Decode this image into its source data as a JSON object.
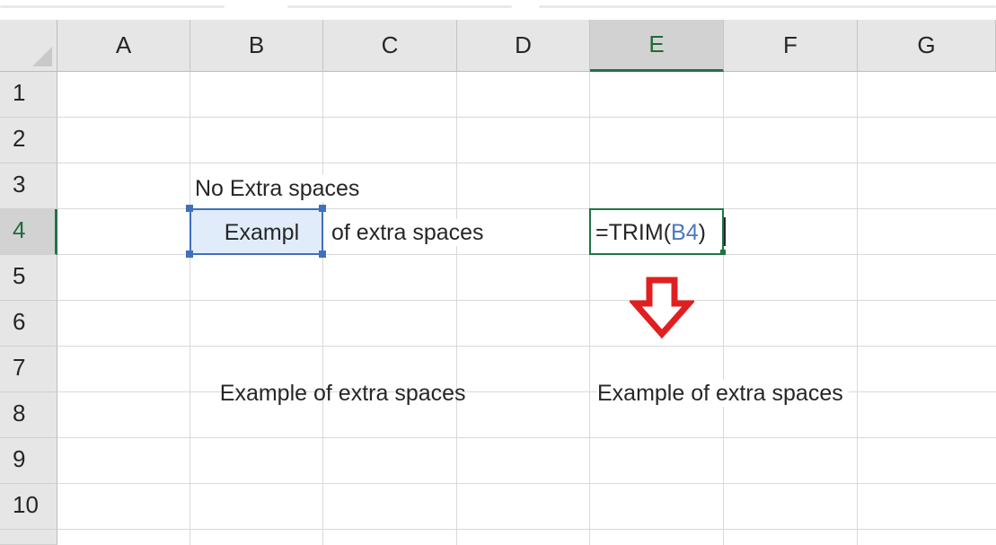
{
  "columns": [
    "A",
    "B",
    "C",
    "D",
    "E",
    "F",
    "G"
  ],
  "active_column": "E",
  "rows": [
    "1",
    "2",
    "3",
    "4",
    "5",
    "6",
    "7",
    "8",
    "9",
    "10"
  ],
  "active_row": "4",
  "cells": {
    "B3": "No Extra spaces",
    "B4_visible": "    Exampl",
    "C4": "of extra spaces",
    "B7": "    Example of extra spaces",
    "E7": "Example of extra spaces"
  },
  "formula": {
    "prefix": "=TRIM(",
    "ref": "B4",
    "suffix": ")"
  },
  "colors": {
    "grid_line": "#d9d9d9",
    "header_bg": "#e6e6e6",
    "active_green": "#217346",
    "ref_blue": "#3f6fbf",
    "arrow_red": "#e02020"
  },
  "icons": {
    "arrow": "down-arrow-icon"
  }
}
